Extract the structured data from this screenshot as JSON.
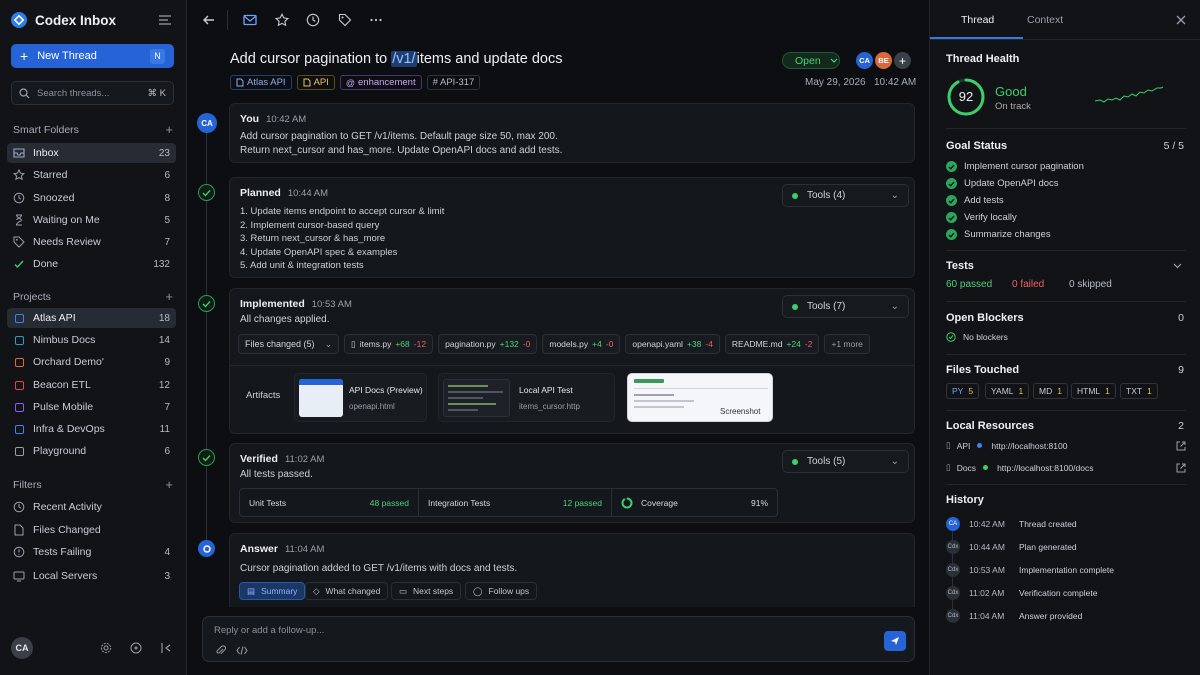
{
  "app": {
    "title": "Codex Inbox"
  },
  "sidebar": {
    "new_thread": "New Thread",
    "new_thread_kbd": "N",
    "search_placeholder": "Search threads...",
    "search_shortcut": "⌘ K",
    "smart_folders_label": "Smart Folders",
    "folders": [
      {
        "label": "Inbox",
        "count": "23",
        "icon": "inbox-icon"
      },
      {
        "label": "Starred",
        "count": "6",
        "icon": "star-icon"
      },
      {
        "label": "Snoozed",
        "count": "8",
        "icon": "clock-icon"
      },
      {
        "label": "Waiting on Me",
        "count": "5",
        "icon": "hourglass-icon"
      },
      {
        "label": "Needs Review",
        "count": "7",
        "icon": "tag-icon"
      },
      {
        "label": "Done",
        "count": "132",
        "icon": "check-icon"
      }
    ],
    "projects_label": "Projects",
    "projects": [
      {
        "label": "Atlas API",
        "count": "18",
        "color": "#3b82f6"
      },
      {
        "label": "Nimbus Docs",
        "count": "14",
        "color": "#22a3c4"
      },
      {
        "label": "Orchard Demo'",
        "count": "9",
        "color": "#e0693a"
      },
      {
        "label": "Beacon ETL",
        "count": "12",
        "color": "#e04848"
      },
      {
        "label": "Pulse Mobile",
        "count": "7",
        "color": "#8b5cf6"
      },
      {
        "label": "Infra & DevOps",
        "count": "11",
        "color": "#3b82f6"
      },
      {
        "label": "Playground",
        "count": "6",
        "color": "#9aa0aa"
      }
    ],
    "filters_label": "Filters",
    "filters": [
      {
        "label": "Recent Activity",
        "count": "",
        "icon": "clock-icon"
      },
      {
        "label": "Files Changed",
        "count": "",
        "icon": "file-icon"
      },
      {
        "label": "Tests Failing",
        "count": "4",
        "icon": "alert-icon"
      },
      {
        "label": "Local Servers",
        "count": "3",
        "icon": "server-icon"
      }
    ],
    "user_initials": "CA"
  },
  "thread": {
    "title_pre": "Add cursor pagination to ",
    "title_hl": "/v1/",
    "title_post": "items and update docs",
    "status": "Open",
    "participants": [
      "CA",
      "BE"
    ],
    "tags": {
      "project": "Atlas API",
      "api": "API",
      "enh": "enhancement",
      "ticket": "# API-317"
    },
    "date": "May 29, 2026",
    "time": "10:42 AM"
  },
  "messages": {
    "you": {
      "author": "You",
      "time": "10:42 AM",
      "line1": "Add cursor pagination to GET /v1/items. Default page size 50, max 200.",
      "line2": "Return next_cursor and has_more. Update OpenAPI docs and add tests.",
      "avatar": "CA"
    },
    "planned": {
      "label": "Planned",
      "time": "10:44 AM",
      "tools": "Tools (4)",
      "steps": [
        "1.  Update items endpoint to accept cursor & limit",
        "2.  Implement cursor-based query",
        "3.  Return next_cursor & has_more",
        "4.  Update OpenAPI spec & examples",
        "5.  Add unit & integration tests"
      ]
    },
    "implemented": {
      "label": "Implemented",
      "time": "10:53 AM",
      "tools": "Tools (7)",
      "summary": "All changes applied.",
      "files_changed": "Files changed (5)",
      "files": [
        {
          "name": "items.py",
          "add": "+68",
          "del": "-12"
        },
        {
          "name": "pagination.py",
          "add": "+132",
          "del": "-0"
        },
        {
          "name": "models.py",
          "add": "+4",
          "del": "-0"
        },
        {
          "name": "openapi.yaml",
          "add": "+38",
          "del": "-4"
        },
        {
          "name": "README.md",
          "add": "+24",
          "del": "-2"
        }
      ],
      "more": "+1 more",
      "artifacts_label": "Artifacts",
      "artifacts": [
        {
          "title": "API Docs (Preview)",
          "sub": "openapi.html"
        },
        {
          "title": "Local API Test",
          "sub": "items_cursor.http"
        },
        {
          "title": "Screenshot",
          "sub": ""
        }
      ]
    },
    "verified": {
      "label": "Verified",
      "time": "11:02 AM",
      "tools": "Tools (5)",
      "summary": "All tests passed.",
      "unit_label": "Unit Tests",
      "unit_val": "48 passed",
      "int_label": "Integration Tests",
      "int_val": "12 passed",
      "cov_label": "Coverage",
      "cov_val": "91%"
    },
    "answer": {
      "label": "Answer",
      "time": "11:04 AM",
      "text": "Cursor pagination added to GET /v1/items with docs and tests.",
      "buttons": [
        "Summary",
        "What changed",
        "Next steps",
        "Follow ups"
      ]
    }
  },
  "composer": {
    "placeholder": "Reply or add a follow-up..."
  },
  "panel": {
    "tabs": [
      "Thread",
      "Context"
    ],
    "health_label": "Thread Health",
    "health_score": "92",
    "health_fraction": 0.92,
    "health_status": "Good",
    "health_sub": "On track",
    "goal_label": "Goal Status",
    "goal_count": "5 / 5",
    "goals": [
      "Implement cursor pagination",
      "Update OpenAPI docs",
      "Add tests",
      "Verify locally",
      "Summarize changes"
    ],
    "tests_label": "Tests",
    "tests_passed": "60 passed",
    "tests_failed": "0  failed",
    "tests_skipped": "0  skipped",
    "blockers_label": "Open Blockers",
    "blockers_count": "0",
    "blockers_text": "No blockers",
    "files_label": "Files Touched",
    "files_count": "9",
    "file_types": [
      {
        "type": "PY",
        "n": "5"
      },
      {
        "type": "YAML",
        "n": "1"
      },
      {
        "type": "MD",
        "n": "1"
      },
      {
        "type": "HTML",
        "n": "1"
      },
      {
        "type": "TXT",
        "n": "1"
      }
    ],
    "resources_label": "Local Resources",
    "resources_count": "2",
    "resources": [
      {
        "name": "API",
        "url": "http://localhost:8100",
        "status_color": "#3b82f6"
      },
      {
        "name": "Docs",
        "url": "http://localhost:8100/docs",
        "status_color": "#3ccf6a"
      }
    ],
    "history_label": "History",
    "history": [
      {
        "avatar": "CA",
        "time": "10:42 AM",
        "event": "Thread created"
      },
      {
        "avatar": "Cdx",
        "time": "10:44 AM",
        "event": "Plan generated"
      },
      {
        "avatar": "Cdx",
        "time": "10:53 AM",
        "event": "Implementation complete"
      },
      {
        "avatar": "Cdx",
        "time": "11:02 AM",
        "event": "Verification complete"
      },
      {
        "avatar": "Cdx",
        "time": "11:04 AM",
        "event": "Answer provided"
      }
    ]
  }
}
